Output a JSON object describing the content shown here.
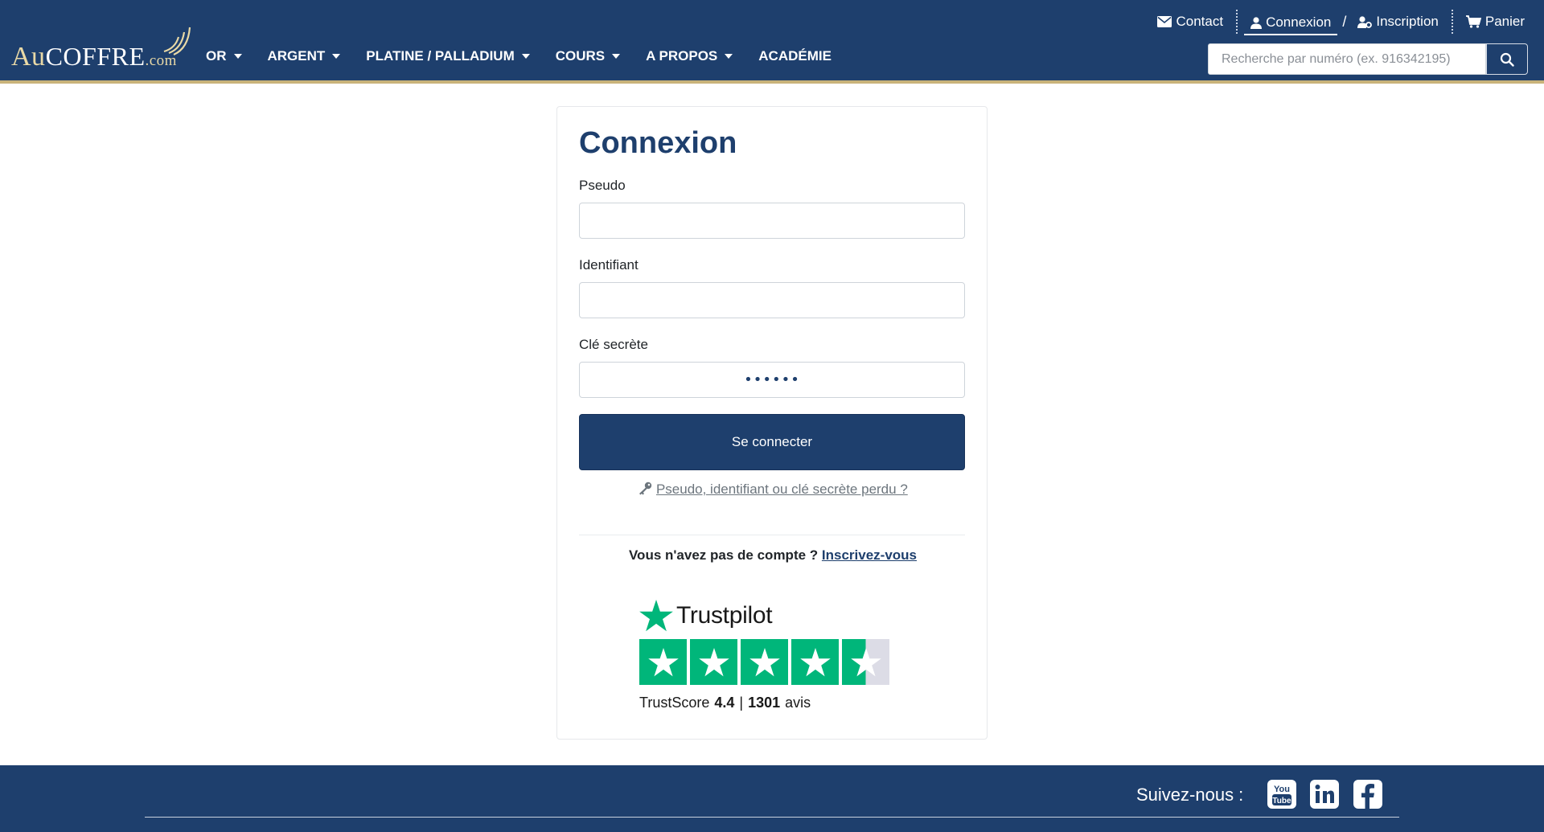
{
  "header": {
    "logo": {
      "au": "Au",
      "coffre": "COFFRE",
      "com": ".com"
    },
    "nav": [
      {
        "label": "OR",
        "caret": true
      },
      {
        "label": "ARGENT",
        "caret": true
      },
      {
        "label": "PLATINE / PALLADIUM",
        "caret": true
      },
      {
        "label": "COURS",
        "caret": true
      },
      {
        "label": "A PROPOS",
        "caret": true
      },
      {
        "label": "ACADÉMIE",
        "caret": false
      }
    ],
    "toplinks": {
      "contact": "Contact",
      "connexion": "Connexion",
      "slash": "/",
      "inscription": "Inscription",
      "panier": "Panier"
    },
    "search": {
      "placeholder": "Recherche par numéro (ex. 916342195)",
      "value": ""
    },
    "colors": {
      "primary": "#1e3f6d",
      "gold": "#c9b37a"
    }
  },
  "login": {
    "title": "Connexion",
    "pseudo_label": "Pseudo",
    "pseudo_value": "",
    "identifiant_label": "Identifiant",
    "identifiant_value": "",
    "cle_label": "Clé secrète",
    "cle_value": "••••••",
    "submit_label": "Se connecter",
    "forgot_link": "Pseudo, identifiant ou clé secrète perdu ?",
    "no_account_text": "Vous n'avez pas de compte ?",
    "signup_link": "Inscrivez-vous"
  },
  "trustpilot": {
    "brand": "Trustpilot",
    "trustscore_label": "TrustScore",
    "score": "4.4",
    "separator": "|",
    "reviews_count": "1301",
    "reviews_label": "avis",
    "rating": 4.5,
    "color": "#00b67a"
  },
  "footer": {
    "follow_label": "Suivez-nous :",
    "social": [
      "youtube-icon",
      "linkedin-icon",
      "facebook-icon"
    ]
  }
}
